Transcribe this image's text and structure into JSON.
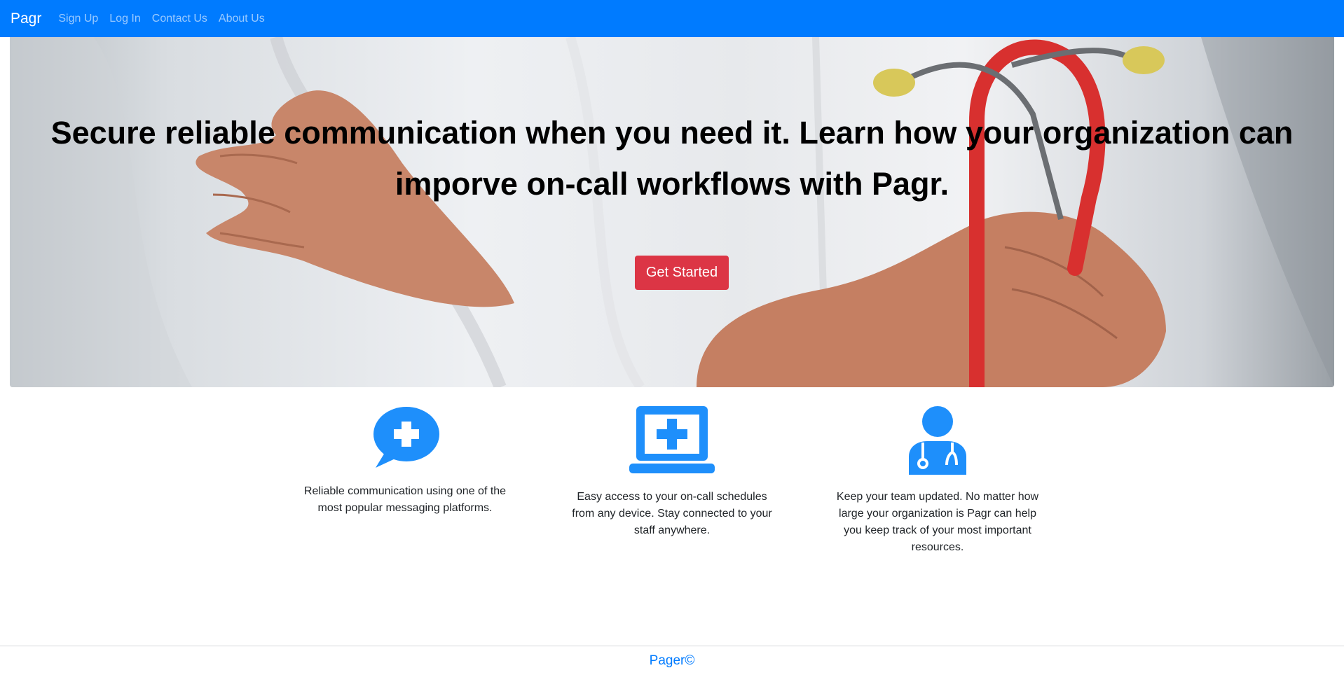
{
  "navbar": {
    "brand": "Pagr",
    "links": [
      "Sign Up",
      "Log In",
      "Contact Us",
      "About Us"
    ]
  },
  "hero": {
    "title": "Secure reliable communication when you need it. Learn how your organization can imporve on-call workflows with Pagr.",
    "cta_label": "Get Started"
  },
  "features": [
    {
      "icon": "comment-medical-icon",
      "text": "Reliable communication using one of the most popular messaging platforms."
    },
    {
      "icon": "laptop-medical-icon",
      "text": "Easy access to your on-call schedules from any device. Stay connected to your staff anywhere."
    },
    {
      "icon": "user-doctor-icon",
      "text": "Keep your team updated. No matter how large your organization is Pagr can help you keep track of your most important resources."
    }
  ],
  "footer": {
    "text": "Pager©"
  },
  "colors": {
    "primary": "#007bff",
    "danger": "#dc3545",
    "icon": "#1e8ffb"
  }
}
